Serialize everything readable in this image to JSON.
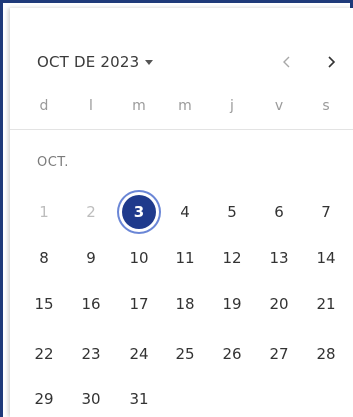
{
  "header": {
    "month_label": "OCT DE 2023",
    "icons": {
      "dropdown": "caret-down-icon",
      "prev": "chevron-left-icon",
      "next": "chevron-right-icon"
    }
  },
  "weekdays": [
    "d",
    "l",
    "m",
    "m",
    "j",
    "v",
    "s"
  ],
  "calendar": {
    "month_label": "OCT.",
    "selected_day": "3",
    "weeks": [
      [
        {
          "d": "1",
          "disabled": true
        },
        {
          "d": "2",
          "disabled": true
        },
        {
          "d": "3",
          "selected": true
        },
        {
          "d": "4"
        },
        {
          "d": "5"
        },
        {
          "d": "6"
        },
        {
          "d": "7"
        }
      ],
      [
        {
          "d": "8"
        },
        {
          "d": "9"
        },
        {
          "d": "10"
        },
        {
          "d": "11"
        },
        {
          "d": "12"
        },
        {
          "d": "13"
        },
        {
          "d": "14"
        }
      ],
      [
        {
          "d": "15"
        },
        {
          "d": "16"
        },
        {
          "d": "17"
        },
        {
          "d": "18"
        },
        {
          "d": "19"
        },
        {
          "d": "20"
        },
        {
          "d": "21"
        }
      ],
      [
        {
          "d": "22"
        },
        {
          "d": "23"
        },
        {
          "d": "24"
        },
        {
          "d": "25"
        },
        {
          "d": "26"
        },
        {
          "d": "27"
        },
        {
          "d": "28"
        }
      ],
      [
        {
          "d": "29"
        },
        {
          "d": "30"
        },
        {
          "d": "31"
        }
      ]
    ]
  },
  "colors": {
    "accent": "#1f3a8c",
    "frame": "#1f3a7a",
    "text": "#333333",
    "muted": "#9a9a9a",
    "disabled": "#bdbdbd"
  }
}
